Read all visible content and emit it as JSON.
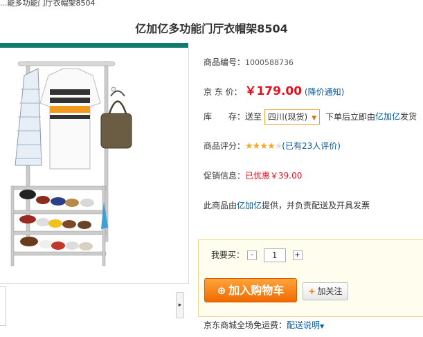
{
  "breadcrumb": "...能多功能门厅衣帽架8504",
  "product_title": "亿加亿多功能门厅衣帽架8504",
  "info": {
    "sku_label": "商品编号：",
    "sku_value": "1000588736",
    "price_label": "京 东 价：",
    "price_value": "￥179.00",
    "price_notice": "(降价通知)",
    "stock_label": "库　　存：",
    "ship_to": "送至",
    "region": "四川(现货)",
    "ship_text_prefix": "下单后立即由",
    "ship_seller": "亿加亿",
    "ship_text_suffix": "发货",
    "rating_label": "商品评分：",
    "stars": "★★★★",
    "half_star": "★",
    "rating_count": "(已有23人评价)",
    "promo_label": "促销信息：",
    "promo_value": "已优惠￥39.00",
    "provider_prefix": "此商品由",
    "provider_name": "亿加亿",
    "provider_suffix": "提供，并负责配送及开具发票"
  },
  "buy": {
    "qty_label": "我要买：",
    "minus": "-",
    "qty": "1",
    "plus": "+",
    "cart_button": "加入购物车",
    "follow_button": "加关注"
  },
  "shipping": {
    "label": "京东商城全场免运费：",
    "link": "配送说明"
  },
  "colors": {
    "accent_green": "#0f7a6d",
    "price_red": "#e3101e",
    "link_blue": "#005aa0",
    "cart_orange": "#f28a1a"
  }
}
